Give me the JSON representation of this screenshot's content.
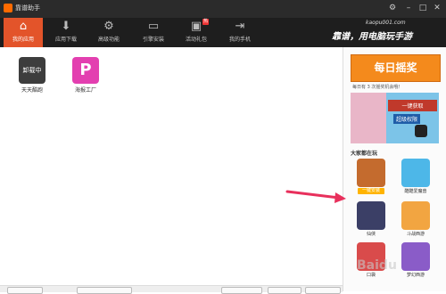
{
  "window": {
    "title": "靠谱助手"
  },
  "toolbar": {
    "tabs": [
      {
        "label": "我的应用",
        "icon": "home-icon"
      },
      {
        "label": "应用下载",
        "icon": "download-icon"
      },
      {
        "label": "高级功能",
        "icon": "gear-icon"
      },
      {
        "label": "引擎安装",
        "icon": "drive-icon"
      },
      {
        "label": "活动礼包",
        "icon": "gift-icon",
        "badge": "热"
      },
      {
        "label": "我的手机",
        "icon": "phone-icon"
      }
    ],
    "brand_url": "kaopu001.com",
    "slogan": "靠谱，用电脑玩手游"
  },
  "apps": [
    {
      "name": "天天酷跑",
      "tile_text": "卸载中"
    },
    {
      "name": "海报工厂",
      "tile_text": "P"
    }
  ],
  "sidebar": {
    "banner": "每日摇奖",
    "shake_info": "每日有 3 次摇奖机会哦！",
    "ad_text": "一键获取",
    "ad_text2": "超级权限",
    "popular_title": "大家都在玩",
    "games": [
      {
        "name": "",
        "button": "一键安装"
      },
      {
        "name": "酷酷爱魔兽"
      },
      {
        "name": "仙侠"
      },
      {
        "name": "斗战西游"
      },
      {
        "name": "口袋"
      },
      {
        "name": "梦幻西游"
      }
    ],
    "watermark": "Baidu"
  },
  "colors": {
    "accent": "#e3542a",
    "toolbar_bg": "#1e1e1e",
    "titlebar_bg": "#2b2b2b",
    "banner": "#f48a1c",
    "arrow": "#e8305c"
  }
}
